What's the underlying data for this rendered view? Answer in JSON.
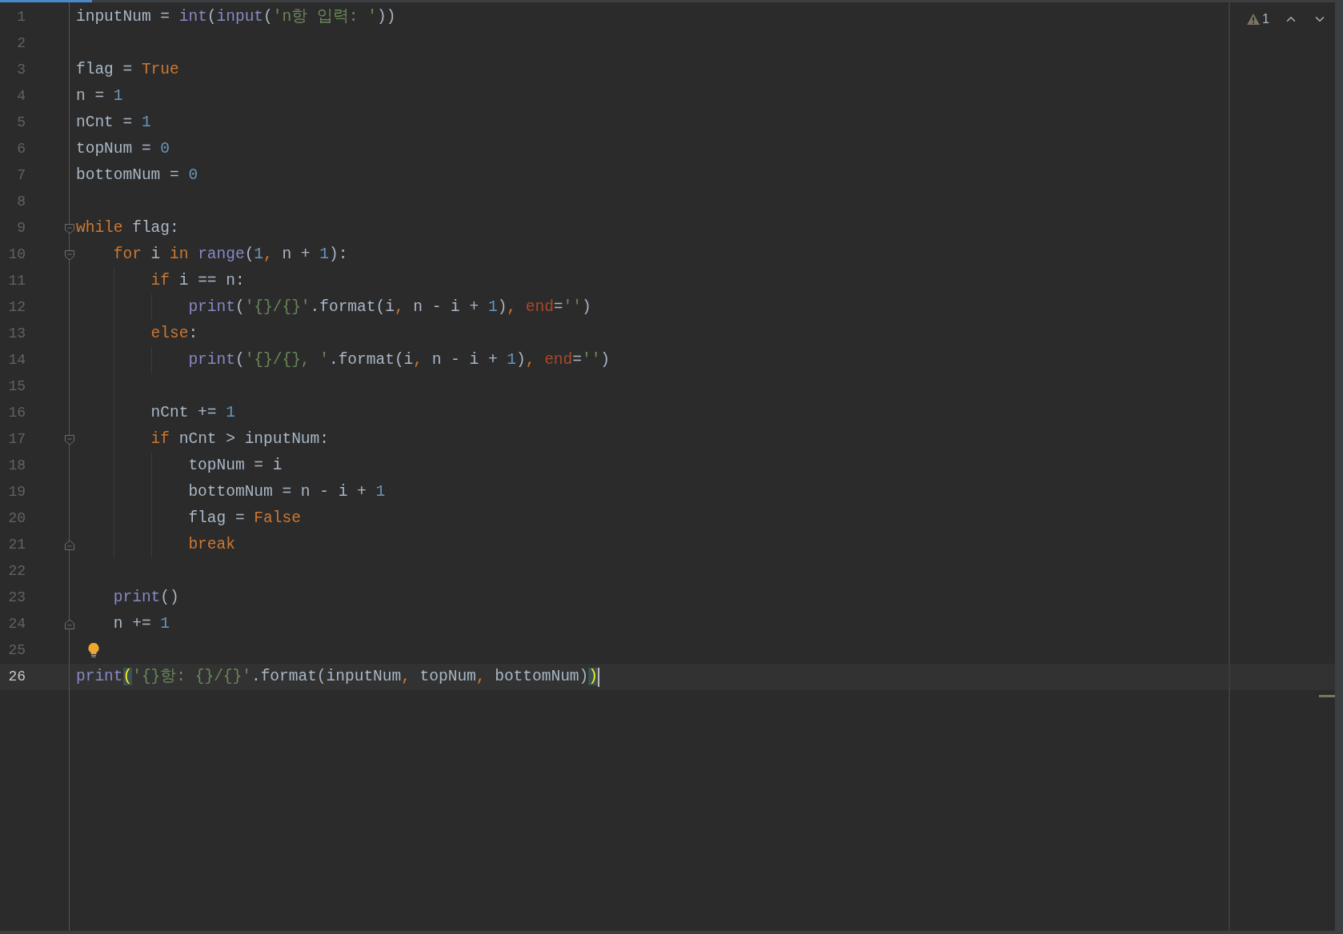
{
  "inspections": {
    "warning_count": "1"
  },
  "lines": [
    {
      "number": "1",
      "tokens": [
        {
          "text": "inputNum = ",
          "kind": "plain"
        },
        {
          "text": "int",
          "kind": "builtin"
        },
        {
          "text": "(",
          "kind": "plain"
        },
        {
          "text": "input",
          "kind": "builtin"
        },
        {
          "text": "(",
          "kind": "plain"
        },
        {
          "text": "'n항 입력: '",
          "kind": "string"
        },
        {
          "text": "))",
          "kind": "plain"
        }
      ]
    },
    {
      "number": "2"
    },
    {
      "number": "3",
      "tokens": [
        {
          "text": "flag = ",
          "kind": "plain"
        },
        {
          "text": "True",
          "kind": "keyword"
        }
      ]
    },
    {
      "number": "4",
      "tokens": [
        {
          "text": "n = ",
          "kind": "plain"
        },
        {
          "text": "1",
          "kind": "number"
        }
      ]
    },
    {
      "number": "5",
      "tokens": [
        {
          "text": "nCnt = ",
          "kind": "plain"
        },
        {
          "text": "1",
          "kind": "number"
        }
      ]
    },
    {
      "number": "6",
      "tokens": [
        {
          "text": "topNum = ",
          "kind": "plain"
        },
        {
          "text": "0",
          "kind": "number"
        }
      ]
    },
    {
      "number": "7",
      "tokens": [
        {
          "text": "bottomNum = ",
          "kind": "plain"
        },
        {
          "text": "0",
          "kind": "number"
        }
      ]
    },
    {
      "number": "8"
    },
    {
      "number": "9",
      "fold_start": true,
      "tokens": [
        {
          "text": "while",
          "kind": "keyword"
        },
        {
          "text": " flag:",
          "kind": "plain"
        }
      ]
    },
    {
      "number": "10",
      "fold_start": true,
      "tokens": [
        {
          "text": "    for",
          "kind": "keyword"
        },
        {
          "text": " i ",
          "kind": "plain"
        },
        {
          "text": "in",
          "kind": "keyword"
        },
        {
          "text": " range",
          "kind": "builtin"
        },
        {
          "text": "(",
          "kind": "plain"
        },
        {
          "text": "1",
          "kind": "number"
        },
        {
          "text": ",",
          "kind": "keyword"
        },
        {
          "text": " n + ",
          "kind": "plain"
        },
        {
          "text": "1",
          "kind": "number"
        },
        {
          "text": "):",
          "kind": "plain"
        }
      ]
    },
    {
      "number": "11",
      "tokens": [
        {
          "text": "        if",
          "kind": "keyword"
        },
        {
          "text": " i == n:",
          "kind": "plain"
        }
      ]
    },
    {
      "number": "12",
      "tokens": [
        {
          "text": "            print",
          "kind": "builtin"
        },
        {
          "text": "(",
          "kind": "plain"
        },
        {
          "text": "'{}/{}'",
          "kind": "string"
        },
        {
          "text": ".format(i",
          "kind": "plain"
        },
        {
          "text": ",",
          "kind": "keyword"
        },
        {
          "text": " n - i + ",
          "kind": "plain"
        },
        {
          "text": "1",
          "kind": "number"
        },
        {
          "text": ")",
          "kind": "plain"
        },
        {
          "text": ",",
          "kind": "keyword"
        },
        {
          "text": " end",
          "kind": "param"
        },
        {
          "text": "=",
          "kind": "plain"
        },
        {
          "text": "''",
          "kind": "string"
        },
        {
          "text": ")",
          "kind": "plain"
        }
      ]
    },
    {
      "number": "13",
      "tokens": [
        {
          "text": "        else",
          "kind": "keyword"
        },
        {
          "text": ":",
          "kind": "plain"
        }
      ]
    },
    {
      "number": "14",
      "tokens": [
        {
          "text": "            print",
          "kind": "builtin"
        },
        {
          "text": "(",
          "kind": "plain"
        },
        {
          "text": "'{}/{}, '",
          "kind": "string"
        },
        {
          "text": ".format(i",
          "kind": "plain"
        },
        {
          "text": ",",
          "kind": "keyword"
        },
        {
          "text": " n - i + ",
          "kind": "plain"
        },
        {
          "text": "1",
          "kind": "number"
        },
        {
          "text": ")",
          "kind": "plain"
        },
        {
          "text": ",",
          "kind": "keyword"
        },
        {
          "text": " end",
          "kind": "param"
        },
        {
          "text": "=",
          "kind": "plain"
        },
        {
          "text": "''",
          "kind": "string"
        },
        {
          "text": ")",
          "kind": "plain"
        }
      ]
    },
    {
      "number": "15"
    },
    {
      "number": "16",
      "tokens": [
        {
          "text": "        nCnt += ",
          "kind": "plain"
        },
        {
          "text": "1",
          "kind": "number"
        }
      ]
    },
    {
      "number": "17",
      "fold_start": true,
      "tokens": [
        {
          "text": "        if",
          "kind": "keyword"
        },
        {
          "text": " nCnt > inputNum:",
          "kind": "plain"
        }
      ]
    },
    {
      "number": "18",
      "tokens": [
        {
          "text": "            topNum = i",
          "kind": "plain"
        }
      ]
    },
    {
      "number": "19",
      "tokens": [
        {
          "text": "            bottomNum = n - i + ",
          "kind": "plain"
        },
        {
          "text": "1",
          "kind": "number"
        }
      ]
    },
    {
      "number": "20",
      "tokens": [
        {
          "text": "            flag = ",
          "kind": "plain"
        },
        {
          "text": "False",
          "kind": "keyword"
        }
      ]
    },
    {
      "number": "21",
      "fold_end": true,
      "tokens": [
        {
          "text": "            break",
          "kind": "keyword"
        }
      ]
    },
    {
      "number": "22"
    },
    {
      "number": "23",
      "tokens": [
        {
          "text": "    print",
          "kind": "builtin"
        },
        {
          "text": "()",
          "kind": "plain"
        }
      ]
    },
    {
      "number": "24",
      "fold_end": true,
      "tokens": [
        {
          "text": "    n += ",
          "kind": "plain"
        },
        {
          "text": "1",
          "kind": "number"
        }
      ]
    },
    {
      "number": "25",
      "bulb": true
    },
    {
      "number": "26",
      "current": true,
      "tokens": [
        {
          "text": "print",
          "kind": "builtin"
        },
        {
          "text": "(",
          "kind": "paren-match"
        },
        {
          "text": "'{}항: {}/{}'",
          "kind": "string"
        },
        {
          "text": ".format(inputNum",
          "kind": "plain"
        },
        {
          "text": ",",
          "kind": "keyword"
        },
        {
          "text": " topNum",
          "kind": "plain"
        },
        {
          "text": ",",
          "kind": "keyword"
        },
        {
          "text": " bottomNum)",
          "kind": "plain"
        },
        {
          "text": ")",
          "kind": "paren-match"
        }
      ]
    }
  ]
}
